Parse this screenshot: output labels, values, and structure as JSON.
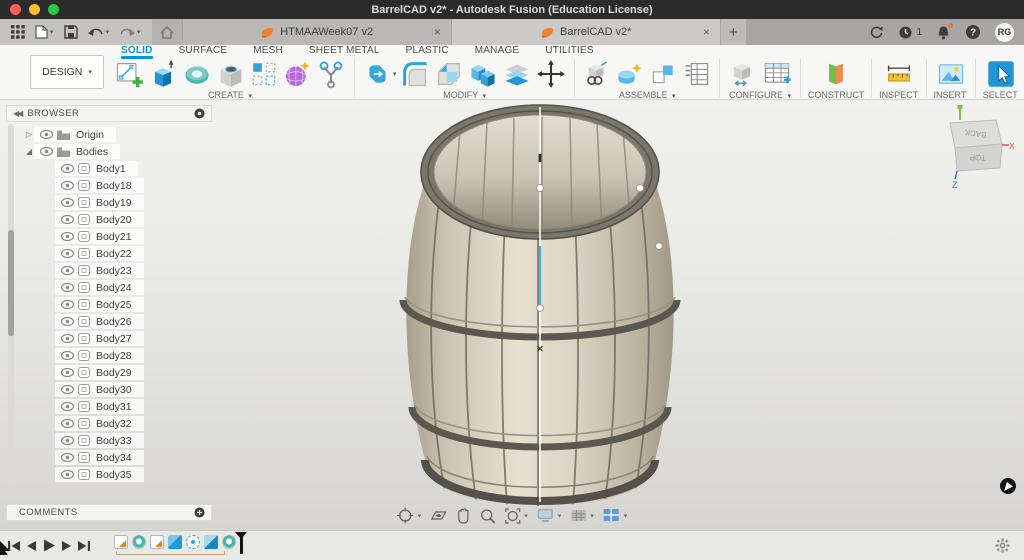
{
  "window": {
    "title": "BarrelCAD v2* - Autodesk Fusion (Education License)"
  },
  "icons": {
    "close": "×",
    "plus": "+",
    "caret": "▾",
    "collapse": "◀◀",
    "expand_closed": "▷",
    "expand_open": "◢",
    "question": "?"
  },
  "tabs": [
    {
      "label": "HTMAAWeek07 v2",
      "active": false
    },
    {
      "label": "BarrelCAD v2*",
      "active": true
    }
  ],
  "top_right": {
    "job_count": "1",
    "avatar_initials": "RG"
  },
  "workspace_switcher": {
    "label": "DESIGN"
  },
  "ribbon": {
    "tabs": [
      {
        "label": "SOLID",
        "active": true
      },
      {
        "label": "SURFACE"
      },
      {
        "label": "MESH"
      },
      {
        "label": "SHEET METAL"
      },
      {
        "label": "PLASTIC"
      },
      {
        "label": "MANAGE"
      },
      {
        "label": "UTILITIES"
      }
    ],
    "groups": {
      "create": "CREATE",
      "modify": "MODIFY",
      "assemble": "ASSEMBLE",
      "configure": "CONFIGURE",
      "construct": "CONSTRUCT",
      "inspect": "INSPECT",
      "insert": "INSERT",
      "select": "SELECT"
    }
  },
  "browser": {
    "title": "BROWSER",
    "folders": [
      {
        "label": "Origin",
        "expanded": false
      },
      {
        "label": "Bodies",
        "expanded": true
      }
    ],
    "bodies": [
      "Body1",
      "Body18",
      "Body19",
      "Body20",
      "Body21",
      "Body22",
      "Body23",
      "Body24",
      "Body25",
      "Body26",
      "Body27",
      "Body28",
      "Body29",
      "Body30",
      "Body31",
      "Body32",
      "Body33",
      "Body34",
      "Body35"
    ]
  },
  "comments": {
    "title": "COMMENTS"
  },
  "viewcube": {
    "face_top": "TOP",
    "face_back": "BACK",
    "axis_x": "X",
    "axis_z": "Z"
  },
  "timeline": {
    "features": [
      "sketch",
      "revolve",
      "sketch",
      "extrude",
      "circular-pattern",
      "combine",
      "revolve"
    ]
  },
  "navbar": {
    "tools": [
      "orbit",
      "look-at",
      "pan",
      "zoom",
      "fit",
      "display-settings",
      "grid-and-snaps",
      "viewports"
    ]
  },
  "colors": {
    "accent": "#0696d7",
    "notification": "#e8762d",
    "fusion_orange": "#f08032"
  }
}
